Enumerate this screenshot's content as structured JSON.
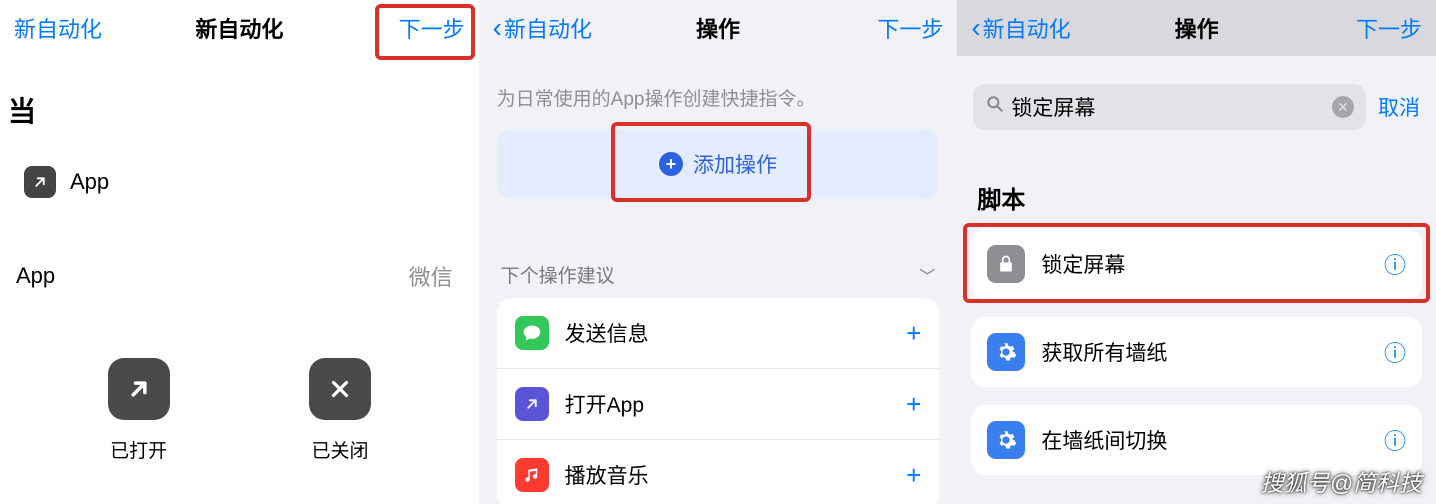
{
  "pane1": {
    "nav": {
      "left": "新自动化",
      "title": "新自动化",
      "right": "下一步"
    },
    "when_header": "当",
    "app_row": {
      "label": "App"
    },
    "select_row": {
      "key": "App",
      "value": "微信"
    },
    "btn_open": {
      "label": "已打开"
    },
    "btn_close": {
      "label": "已关闭"
    }
  },
  "pane2": {
    "nav": {
      "back": "新自动化",
      "title": "操作",
      "right": "下一步"
    },
    "subtitle": "为日常使用的App操作创建快捷指令。",
    "add_action": "添加操作",
    "suggest_header": "下个操作建议",
    "items": [
      {
        "label": "发送信息",
        "color": "#34c759"
      },
      {
        "label": "打开App",
        "color": "#5856d6"
      },
      {
        "label": "播放音乐",
        "color": "#ff3b30"
      }
    ]
  },
  "pane3": {
    "nav": {
      "back": "新自动化",
      "title": "操作",
      "right": "下一步"
    },
    "search_value": "锁定屏幕",
    "cancel": "取消",
    "section": "脚本",
    "cards": [
      {
        "label": "锁定屏幕",
        "icon": "lock",
        "bg": "#8e8e93"
      },
      {
        "label": "获取所有墙纸",
        "icon": "gear",
        "bg": "#3a7ff0"
      },
      {
        "label": "在墙纸间切换",
        "icon": "gear",
        "bg": "#3a7ff0"
      }
    ]
  },
  "watermark": "搜狐号@简科技"
}
